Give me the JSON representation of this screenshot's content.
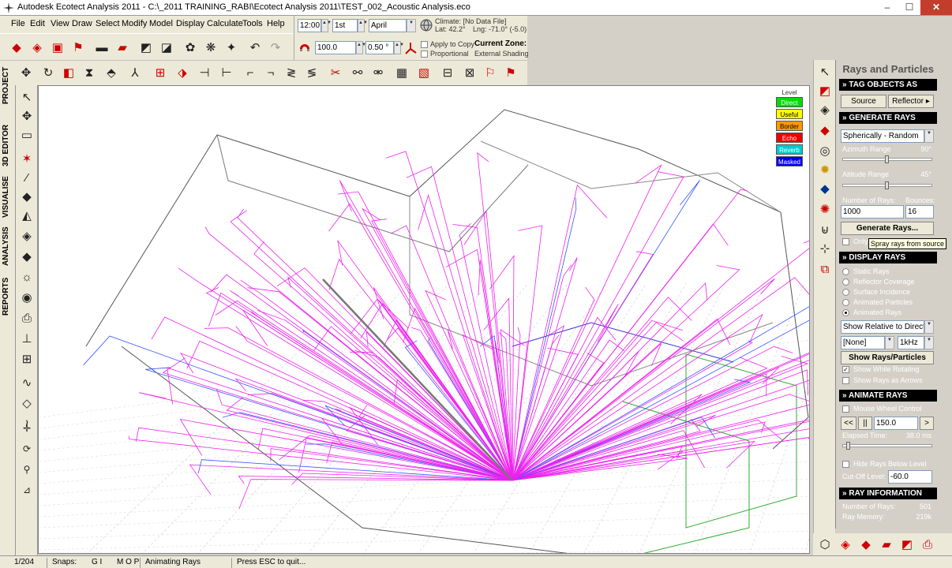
{
  "window": {
    "title": "Autodesk Ecotect Analysis 2011 - C:\\_2011 TRAINING_RABI\\Ecotect Analysis 2011\\TEST_002_Acoustic Analysis.eco",
    "minimize": "–",
    "maximize": "☐",
    "close": "✕"
  },
  "menu": {
    "items": [
      "File",
      "Edit",
      "View",
      "Draw",
      "Select",
      "Modify",
      "Model",
      "Display",
      "Calculate",
      "Tools",
      "Help"
    ]
  },
  "top_controls": {
    "time": "12:00",
    "day": "1st",
    "month": "April",
    "climate_label": "Climate: [No Data File]",
    "lat": "Lat: 42.2°",
    "lng": "Lng: -71.0° (-5.0)",
    "scale": "100.0",
    "offset": "0.50 °",
    "apply_to_copy": "Apply to Copy",
    "proportional": "Proportional",
    "current_zone_label": "Current Zone:",
    "current_zone_value": "External Shading"
  },
  "left_tabs": [
    "PROJECT",
    "3D EDITOR",
    "VISUALISE",
    "ANALYSIS",
    "REPORTS"
  ],
  "legend": {
    "title": "Level",
    "items": [
      {
        "label": "Direct",
        "color": "#00dd00",
        "text": "#ffffff"
      },
      {
        "label": "Useful",
        "color": "#ffff00",
        "text": "#000000"
      },
      {
        "label": "Border",
        "color": "#ff9900",
        "text": "#000000"
      },
      {
        "label": "Echo",
        "color": "#ee0000",
        "text": "#ffffff"
      },
      {
        "label": "Reverb",
        "color": "#00cccc",
        "text": "#ffffff"
      },
      {
        "label": "Masked",
        "color": "#0000ee",
        "text": "#ffffff"
      }
    ]
  },
  "panel": {
    "title": "Rays and Particles",
    "tag_objects": {
      "header": "TAG OBJECTS AS",
      "source_btn": "Source",
      "reflector_btn": "Reflector"
    },
    "generate": {
      "header": "GENERATE RAYS",
      "mode": "Spherically - Random",
      "azimuth_label": "Azimuth Range",
      "azimuth_value": "90°",
      "azimuth_level": 0.5,
      "altitude_label": "Altitude Range",
      "altitude_value": "45°",
      "altitude_level": 0.5,
      "num_rays_label": "Number of Rays:",
      "bounces_label": "Bounces:",
      "num_rays": "1000",
      "bounces": "16",
      "generate_btn": "Generate Rays...",
      "only_label": "Only"
    },
    "tooltip": "Spray rays from source",
    "display": {
      "header": "DISPLAY RAYS",
      "options": [
        "Static Rays",
        "Reflector Coverage",
        "Surface Incidence",
        "Animated Particles",
        "Animated Rays"
      ],
      "selected": 4,
      "relative": "Show Relative to Direct",
      "filter": "[None]",
      "freq": "1kHz",
      "show_btn": "Show Rays/Particles",
      "show_while_rotating": "Show While Rotating",
      "show_as_arrows": "Show Rays as Arrows"
    },
    "animate": {
      "header": "ANIMATE RAYS",
      "mouse_wheel": "Mouse Wheel Control",
      "rewind": "<<",
      "pause": "||",
      "speed": "150.0",
      "play": ">",
      "elapsed_label": "Elapsed Time:",
      "elapsed_value": "38.0 ms",
      "elapsed_level": 0.05,
      "hide_below": "Hide Rays Below Level",
      "cutoff_label": "Cut-Off Level:",
      "cutoff_value": "-60.0"
    },
    "info": {
      "header": "RAY INFORMATION",
      "num_rays_label": "Number of Rays:",
      "num_rays_value": "501",
      "memory_label": "Ray Memory:",
      "memory_value": "219k"
    }
  },
  "status": {
    "count": "1/204",
    "snaps_label": "Snaps:",
    "snaps1": "G I",
    "snaps2": "M O P",
    "mode": "Animating Rays",
    "hint": "Press ESC to quit..."
  }
}
